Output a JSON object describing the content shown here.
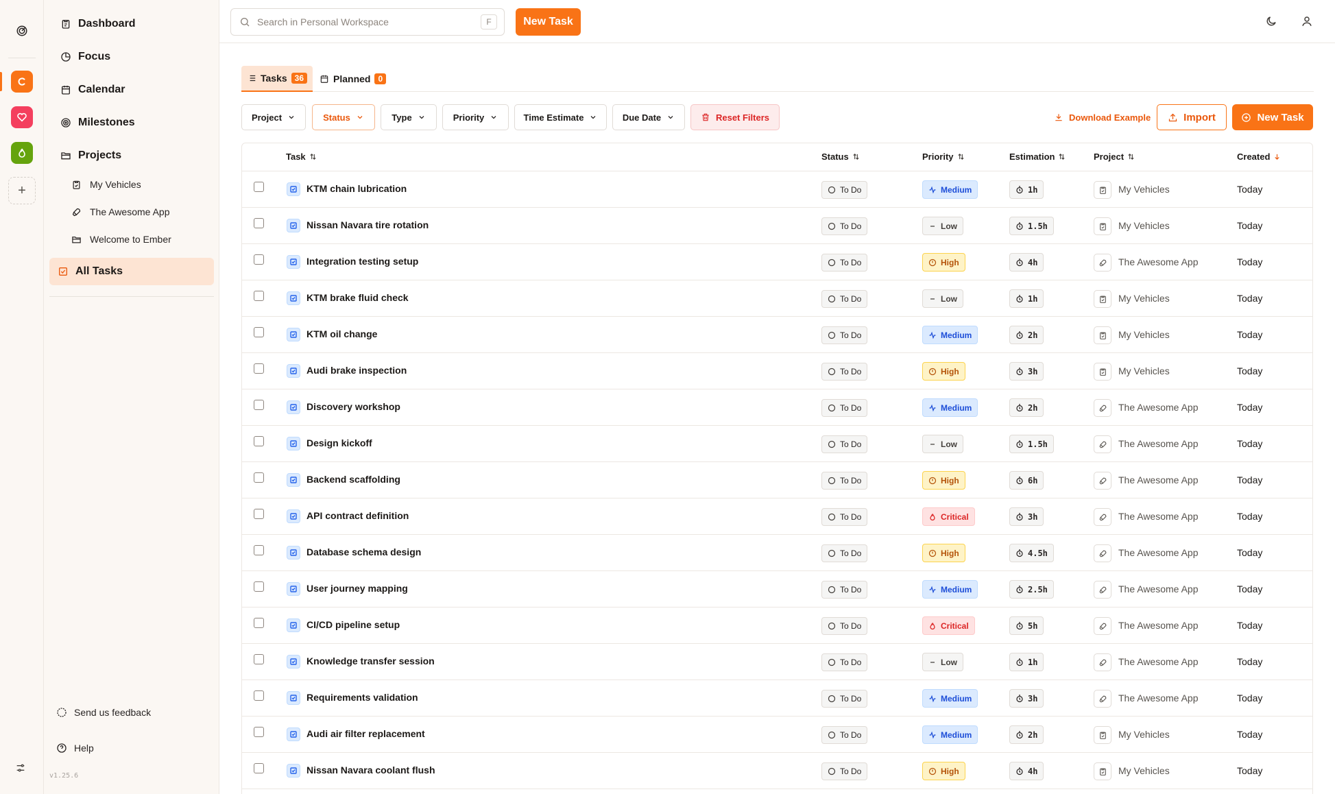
{
  "sidebar": {
    "nav": {
      "dashboard": "Dashboard",
      "focus": "Focus",
      "calendar": "Calendar",
      "milestones": "Milestones",
      "projects": "Projects",
      "all_tasks": "All Tasks"
    },
    "projects": [
      "My Vehicles",
      "The Awesome App",
      "Welcome to Ember"
    ],
    "feedback": "Send us feedback",
    "help": "Help",
    "version": "v1.25.6"
  },
  "topbar": {
    "search_placeholder": "Search in Personal Workspace",
    "search_shortcut": "F",
    "new_task": "New Task"
  },
  "tabs": {
    "tasks_label": "Tasks",
    "tasks_count": "36",
    "planned_label": "Planned",
    "planned_count": "0"
  },
  "filters": {
    "project": "Project",
    "status": "Status",
    "type": "Type",
    "priority": "Priority",
    "time_estimate": "Time Estimate",
    "due_date": "Due Date",
    "reset": "Reset Filters",
    "download_example": "Download Example",
    "import": "Import",
    "new_task": "New Task"
  },
  "table": {
    "headers": {
      "task": "Task",
      "status": "Status",
      "priority": "Priority",
      "estimation": "Estimation",
      "project": "Project",
      "created": "Created"
    },
    "rows": [
      {
        "title": "KTM chain lubrication",
        "status": "To Do",
        "priority": "Medium",
        "estimate": "1h",
        "project": "My Vehicles",
        "created": "Today"
      },
      {
        "title": "Nissan Navara tire rotation",
        "status": "To Do",
        "priority": "Low",
        "estimate": "1.5h",
        "project": "My Vehicles",
        "created": "Today"
      },
      {
        "title": "Integration testing setup",
        "status": "To Do",
        "priority": "High",
        "estimate": "4h",
        "project": "The Awesome App",
        "created": "Today"
      },
      {
        "title": "KTM brake fluid check",
        "status": "To Do",
        "priority": "Low",
        "estimate": "1h",
        "project": "My Vehicles",
        "created": "Today"
      },
      {
        "title": "KTM oil change",
        "status": "To Do",
        "priority": "Medium",
        "estimate": "2h",
        "project": "My Vehicles",
        "created": "Today"
      },
      {
        "title": "Audi brake inspection",
        "status": "To Do",
        "priority": "High",
        "estimate": "3h",
        "project": "My Vehicles",
        "created": "Today"
      },
      {
        "title": "Discovery workshop",
        "status": "To Do",
        "priority": "Medium",
        "estimate": "2h",
        "project": "The Awesome App",
        "created": "Today"
      },
      {
        "title": "Design kickoff",
        "status": "To Do",
        "priority": "Low",
        "estimate": "1.5h",
        "project": "The Awesome App",
        "created": "Today"
      },
      {
        "title": "Backend scaffolding",
        "status": "To Do",
        "priority": "High",
        "estimate": "6h",
        "project": "The Awesome App",
        "created": "Today"
      },
      {
        "title": "API contract definition",
        "status": "To Do",
        "priority": "Critical",
        "estimate": "3h",
        "project": "The Awesome App",
        "created": "Today"
      },
      {
        "title": "Database schema design",
        "status": "To Do",
        "priority": "High",
        "estimate": "4.5h",
        "project": "The Awesome App",
        "created": "Today"
      },
      {
        "title": "User journey mapping",
        "status": "To Do",
        "priority": "Medium",
        "estimate": "2.5h",
        "project": "The Awesome App",
        "created": "Today"
      },
      {
        "title": "CI/CD pipeline setup",
        "status": "To Do",
        "priority": "Critical",
        "estimate": "5h",
        "project": "The Awesome App",
        "created": "Today"
      },
      {
        "title": "Knowledge transfer session",
        "status": "To Do",
        "priority": "Low",
        "estimate": "1h",
        "project": "The Awesome App",
        "created": "Today"
      },
      {
        "title": "Requirements validation",
        "status": "To Do",
        "priority": "Medium",
        "estimate": "3h",
        "project": "The Awesome App",
        "created": "Today"
      },
      {
        "title": "Audi air filter replacement",
        "status": "To Do",
        "priority": "Medium",
        "estimate": "2h",
        "project": "My Vehicles",
        "created": "Today"
      },
      {
        "title": "Nissan Navara coolant flush",
        "status": "To Do",
        "priority": "High",
        "estimate": "4h",
        "project": "My Vehicles",
        "created": "Today"
      }
    ]
  },
  "colors": {
    "accent": "#f97316",
    "medium": "#1d4ed8",
    "high": "#b45309",
    "critical": "#dc2626"
  }
}
